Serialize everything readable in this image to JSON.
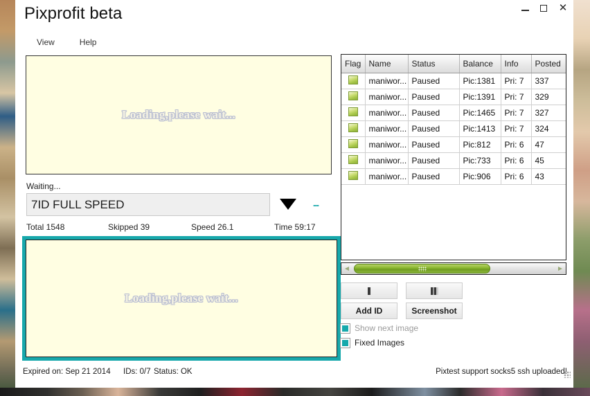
{
  "window": {
    "title": "Pixprofit beta",
    "controls": {
      "minimize": "–",
      "maximize": "□",
      "close": "✕"
    }
  },
  "menubar": {
    "items": [
      {
        "label": "View"
      },
      {
        "label": "Help"
      }
    ]
  },
  "preview_top": {
    "text": "Loading,please wait..."
  },
  "preview_bottom": {
    "text": "Loading,please wait...",
    "border_color": "#17a8ab"
  },
  "status": {
    "waiting_label": "Waiting...",
    "speed_value": "7ID FULL SPEED",
    "dash_indicator": "--",
    "total": "Total 1548",
    "skipped": "Skipped 39",
    "speed": "Speed 26.1",
    "time": "Time 59:17"
  },
  "table": {
    "columns": [
      "Flag",
      "Name",
      "Status",
      "Balance",
      "Info",
      "Posted"
    ],
    "rows": [
      {
        "flag": "green-flag-icon",
        "name": "maniwor...",
        "status": "Paused",
        "balance": "Pic:1381",
        "info": "Pri: 7",
        "posted": "337"
      },
      {
        "flag": "green-flag-icon",
        "name": "maniwor...",
        "status": "Paused",
        "balance": "Pic:1391",
        "info": "Pri: 7",
        "posted": "329"
      },
      {
        "flag": "green-flag-icon",
        "name": "maniwor...",
        "status": "Paused",
        "balance": "Pic:1465",
        "info": "Pri: 7",
        "posted": "327"
      },
      {
        "flag": "green-flag-icon",
        "name": "maniwor...",
        "status": "Paused",
        "balance": "Pic:1413",
        "info": "Pri: 7",
        "posted": "324"
      },
      {
        "flag": "green-flag-icon",
        "name": "maniwor...",
        "status": "Paused",
        "balance": "Pic:812",
        "info": "Pri: 6",
        "posted": "47"
      },
      {
        "flag": "green-flag-icon",
        "name": "maniwor...",
        "status": "Paused",
        "balance": "Pic:733",
        "info": "Pri: 6",
        "posted": "45"
      },
      {
        "flag": "green-flag-icon",
        "name": "maniwor...",
        "status": "Paused",
        "balance": "Pic:906",
        "info": "Pri: 6",
        "posted": "43"
      }
    ]
  },
  "scrollbar": {
    "left_arrow": "◄",
    "right_arrow": "►",
    "thumb_color": "#8db833"
  },
  "buttons": {
    "pause": {
      "icon": "pause-icon",
      "label": ""
    },
    "stop": {
      "icon": "stop-icon",
      "label": ""
    },
    "add_id": "Add ID",
    "screenshot": "Screenshot"
  },
  "checkboxes": [
    {
      "label": "Show next image",
      "checked": true,
      "disabled": true,
      "color": "#16a9ac"
    },
    {
      "label": "Fixed Images",
      "checked": true,
      "disabled": false,
      "color": "#16a9ac"
    }
  ],
  "footer": {
    "expired": "Expired on: Sep 21 2014",
    "ids": "IDs: 0/7",
    "status": "Status: OK",
    "right_note": "Pixtest support socks5  ssh uploaded!"
  }
}
